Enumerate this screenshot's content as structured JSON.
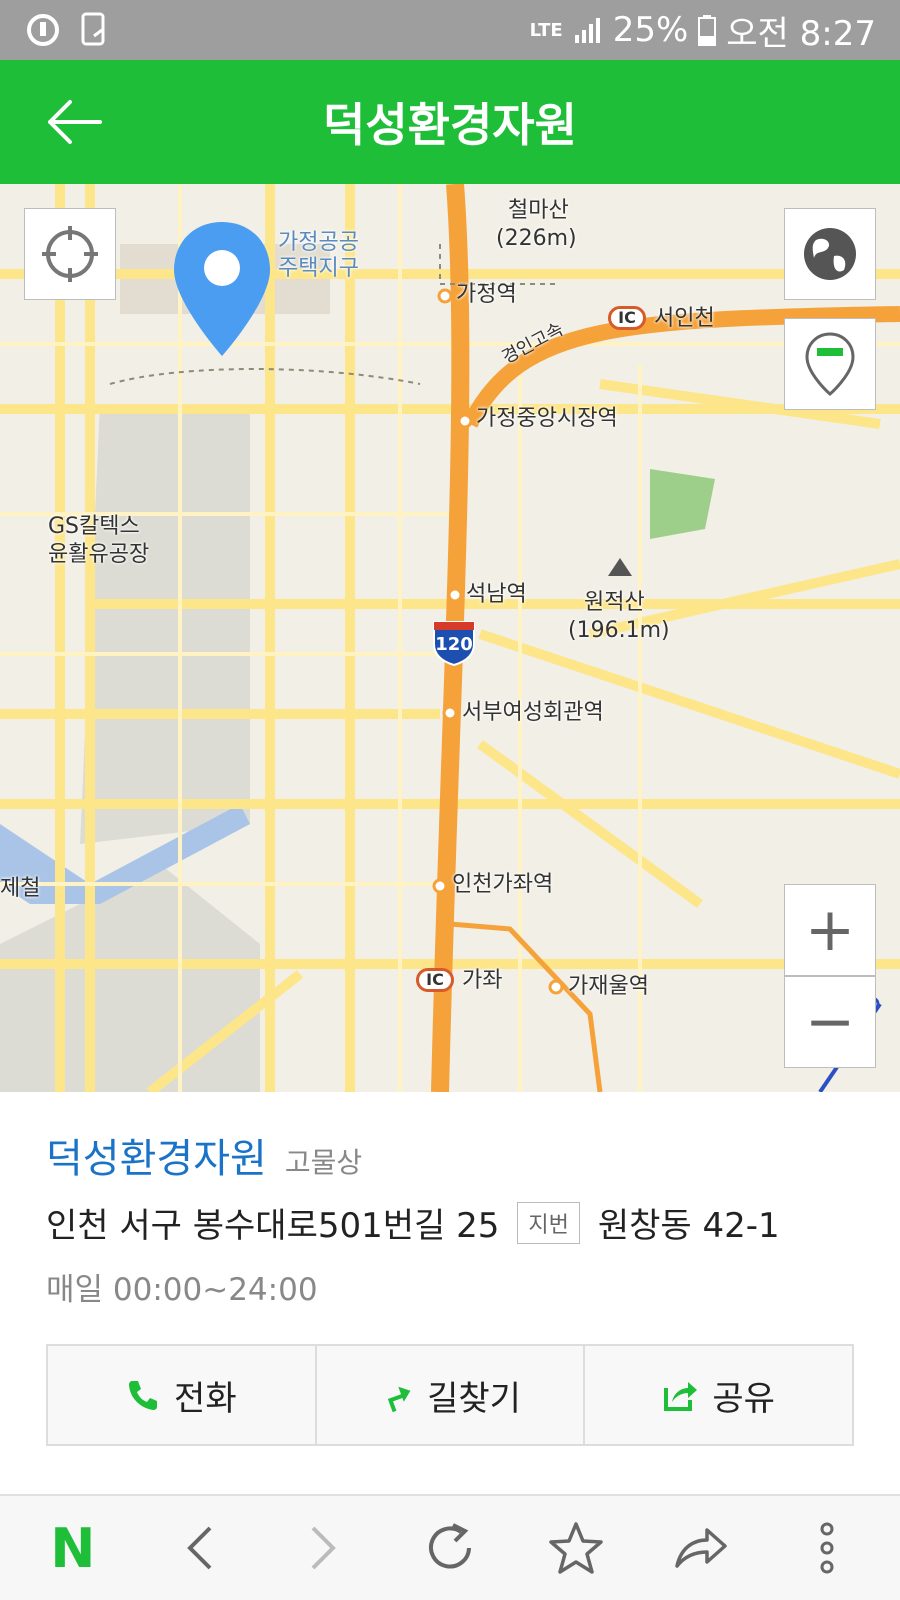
{
  "status_bar": {
    "network": "LTE",
    "battery": "25%",
    "time": "오전 8:27"
  },
  "app_bar": {
    "title": "덕성환경자원",
    "back_icon": "arrow-left-icon"
  },
  "map": {
    "labels": {
      "cheolmasan": "철마산",
      "cheolmasan_height": "(226m)",
      "gajeong_housing": "가정공공",
      "gajeong_housing2": "주택지구",
      "gajeong_station": "가정역",
      "seoincheon_ic": "서인천",
      "ic": "IC",
      "expressway": "경인고속",
      "gajeong_market_station": "가정중앙시장역",
      "gs_caltex": "GS칼텍스",
      "gs_caltex2": "윤활유공장",
      "seoknam_station": "석남역",
      "wonjeoksan": "원적산",
      "wonjeoksan_height": "(196.1m)",
      "route_number": "120",
      "seobu_station": "서부여성회관역",
      "gajwa_station": "인천가좌역",
      "gajwa_ic": "가좌",
      "gajaeul_station": "가재울역",
      "steel": "제철"
    },
    "controls": {
      "locate_icon": "crosshair-icon",
      "globe_icon": "globe-icon",
      "pin_icon": "map-pin-icon",
      "zoom_in": "+",
      "zoom_out": "−"
    },
    "marker_color": "#4a9df0"
  },
  "place": {
    "name": "덕성환경자원",
    "category": "고물상",
    "address": "인천 서구 봉수대로501번길 25",
    "jibun_badge": "지번",
    "jibun_address": "원창동 42-1",
    "hours": "매일 00:00~24:00"
  },
  "actions": [
    {
      "label": "전화",
      "icon": "phone-icon"
    },
    {
      "label": "길찾기",
      "icon": "directions-icon"
    },
    {
      "label": "공유",
      "icon": "share-icon"
    }
  ],
  "bottom_bar": {
    "logo": "N",
    "icons": [
      "naver-logo-icon",
      "back-icon",
      "forward-icon",
      "refresh-icon",
      "star-icon",
      "share-arrow-icon",
      "more-icon"
    ]
  },
  "colors": {
    "brand_green": "#1ebe39",
    "link_blue": "#1a73c8",
    "road_yellow": "#fde68a",
    "highway_orange": "#f5a23a"
  }
}
